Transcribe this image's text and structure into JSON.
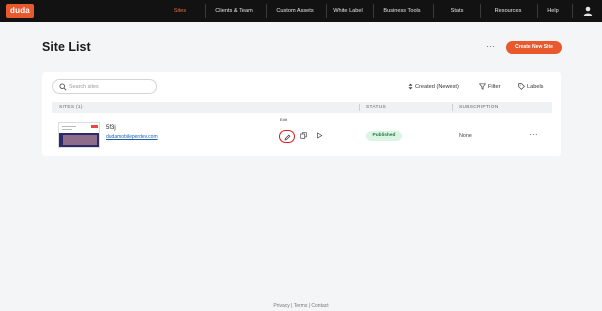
{
  "nav": {
    "logo": "duda",
    "items": [
      {
        "label": "Sites",
        "active": true
      },
      {
        "label": "Clients & Team"
      },
      {
        "label": "Custom Assets"
      },
      {
        "label": "White Label"
      },
      {
        "label": "Business Tools"
      },
      {
        "label": "Stats"
      },
      {
        "label": "Resources"
      },
      {
        "label": "Help"
      }
    ],
    "user_icon": "user-icon"
  },
  "header": {
    "title": "Site List",
    "more_label": "···",
    "create_label": "Create New Site"
  },
  "toolbar": {
    "search_placeholder": "Search sites",
    "sort_label": "Created (Newest)",
    "filter_label": "Filter",
    "labels_label": "Labels"
  },
  "table": {
    "columns": [
      "SITES (1)",
      "STATUS",
      "SUBSCRIPTION"
    ],
    "rows": [
      {
        "name": "5f3j",
        "url": "dudamobileperdev.com",
        "edit_tooltip": "Edit",
        "status": "Published",
        "subscription": "None",
        "more": "···"
      }
    ]
  },
  "footer": {
    "text": "Privacy | Terms | Contact"
  },
  "colors": {
    "accent": "#e8592e",
    "nav_bg": "#121212",
    "published_bg": "#dcf4e4",
    "published_fg": "#1f7a43",
    "highlight_ring": "#d61d1d"
  }
}
